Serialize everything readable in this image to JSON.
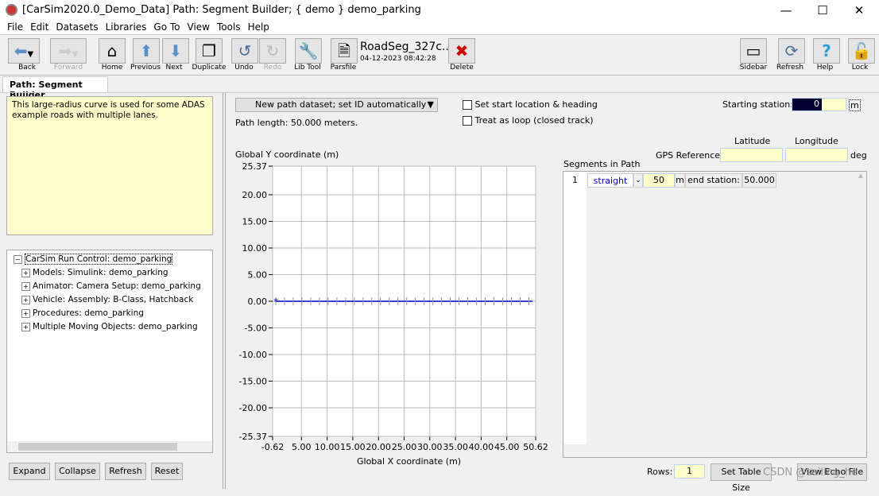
{
  "window": {
    "title": "[CarSim2020.0_Demo_Data] Path: Segment Builder; { demo } demo_parking",
    "minimize": "—",
    "maximize": "☐",
    "close": "✕"
  },
  "menu": [
    "File",
    "Edit",
    "Datasets",
    "Libraries",
    "Go To",
    "View",
    "Tools",
    "Help"
  ],
  "toolbar": {
    "back": "Back",
    "forward": "Forward",
    "home": "Home",
    "previous": "Previous",
    "next": "Next",
    "duplicate": "Duplicate",
    "undo": "Undo",
    "redo": "Redo",
    "libtool": "Lib Tool",
    "parsfile": "Parsfile",
    "dataset_name": "RoadSeg_327c..",
    "dataset_date": "04-12-2023 08:42:28",
    "delete": "Delete",
    "sidebar": "Sidebar",
    "refresh": "Refresh",
    "help": "Help",
    "lock": "Lock"
  },
  "tab": "Path: Segment Builder",
  "notes": "This large-radius curve is used for some ADAS example roads with multiple lanes.",
  "tree": {
    "root": "CarSim Run Control: demo_parking",
    "children": [
      "Models: Simulink: demo_parking",
      "Animator: Camera Setup: demo_parking",
      "Vehicle: Assembly: B-Class, Hatchback",
      "Procedures: demo_parking",
      "Multiple Moving Objects: demo_parking"
    ]
  },
  "left_buttons": {
    "expand": "Expand",
    "collapse": "Collapse",
    "refresh": "Refresh",
    "reset": "Reset"
  },
  "main": {
    "dataset_select": "New path dataset; set ID automatically",
    "path_length": "Path length: 50.000 meters.",
    "set_start": "Set start location & heading",
    "treat_loop": "Treat as loop (closed track)",
    "starting_station_label": "Starting station:",
    "starting_station": "0",
    "starting_station_unit": "m",
    "latitude": "Latitude",
    "longitude": "Longitude",
    "gps_label": "GPS References",
    "gps_unit": "deg",
    "segments_label": "Segments in Path",
    "rows_label": "Rows:",
    "rows": "1",
    "set_table_size": "Set Table Size",
    "view_echo": "View Echo File"
  },
  "segments": [
    {
      "index": "1",
      "type": "straight",
      "length": "50",
      "unit": "m",
      "end_label": "end station:",
      "end_station": "50.000"
    }
  ],
  "watermark": "CSDN @sailing_he",
  "chart_data": {
    "type": "line",
    "ylabel": "Global Y coordinate (m)",
    "xlabel": "Global X coordinate (m)",
    "xlim": [
      -0.62,
      50.62
    ],
    "ylim": [
      -25.37,
      25.37
    ],
    "xticks": [
      "-0.62",
      "5.00",
      "10.00",
      "15.00",
      "20.00",
      "25.00",
      "30.00",
      "35.00",
      "40.00",
      "45.00",
      "50.62"
    ],
    "xtick_values": [
      -0.62,
      5,
      10,
      15,
      20,
      25,
      30,
      35,
      40,
      45,
      50.62
    ],
    "yticks": [
      "25.37",
      "20.00",
      "15.00",
      "10.00",
      "5.00",
      "0.00",
      "-5.00",
      "-10.00",
      "-15.00",
      "-20.00",
      "-25.37"
    ],
    "ytick_values": [
      25.37,
      20,
      15,
      10,
      5,
      0,
      -5,
      -10,
      -15,
      -20,
      -25.37
    ],
    "grid": true,
    "series": [
      {
        "x": [
          0,
          50
        ],
        "y": [
          0,
          0
        ],
        "color": "#0000cc"
      }
    ]
  }
}
